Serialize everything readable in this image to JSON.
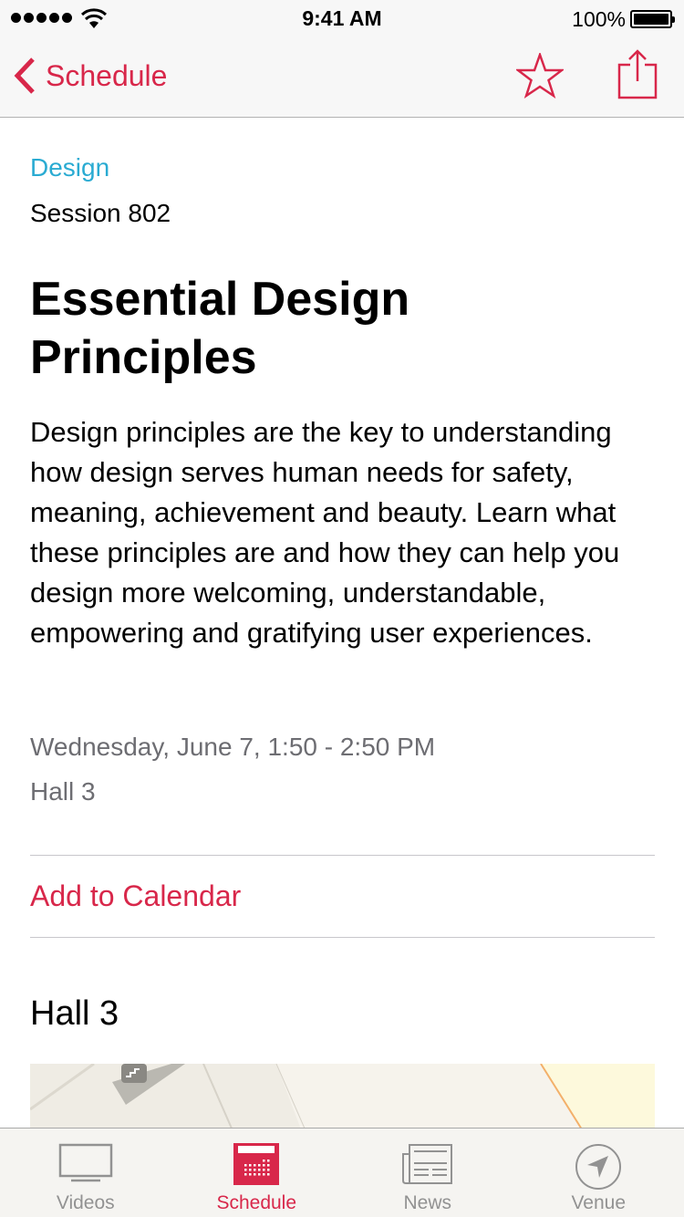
{
  "status_bar": {
    "time": "9:41 AM",
    "battery_percent": "100%",
    "signal_bars": 5
  },
  "nav": {
    "back_label": "Schedule",
    "accent_color": "#d8274a",
    "icons": [
      "chevron-left-icon",
      "star-icon",
      "share-icon"
    ]
  },
  "session": {
    "category": "Design",
    "category_color": "#2aabd2",
    "number": "Session 802",
    "title": "Essential Design Principles",
    "description": "Design principles are the key to understanding how design serves human needs for safety, meaning, achievement and beauty. Learn what these principles are and how they can help you design more welcoming, understandable, empowering and gratifying user experiences.",
    "datetime": "Wednesday, June 7, 1:50 - 2:50 PM",
    "room": "Hall 3",
    "add_to_calendar": "Add to Calendar",
    "map_title": "Hall 3"
  },
  "tab_bar": {
    "active_index": 1,
    "tabs": [
      {
        "label": "Videos",
        "icon": "tv-icon"
      },
      {
        "label": "Schedule",
        "icon": "calendar-icon"
      },
      {
        "label": "News",
        "icon": "newspaper-icon"
      },
      {
        "label": "Venue",
        "icon": "location-arrow-icon"
      }
    ]
  }
}
